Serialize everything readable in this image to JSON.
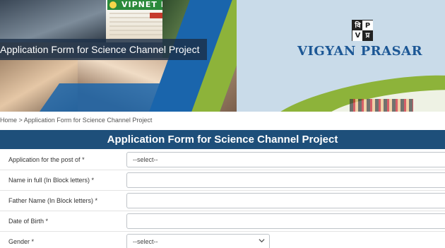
{
  "banner": {
    "title": "Application Form for Science Channel Project",
    "news_head": "VIPNET NEWS",
    "logo_glyphs": [
      "वि",
      "P",
      "V",
      "प्र"
    ],
    "brand_name": "VIGYAN PRASAR"
  },
  "breadcrumb": {
    "home": "Home",
    "separator": " > ",
    "current": "Application Form for Science Channel Project"
  },
  "form": {
    "heading": "Application Form for Science Channel Project",
    "fields": [
      {
        "label": "Application for the post of *",
        "type": "select",
        "value": "--select--"
      },
      {
        "label": "Name in full (In Block letters) *",
        "type": "text",
        "value": ""
      },
      {
        "label": "Father Name (In Block letters) *",
        "type": "text",
        "value": ""
      },
      {
        "label": "Date of Birth *",
        "type": "text",
        "value": ""
      },
      {
        "label": "Gender *",
        "type": "select",
        "value": "--select--"
      }
    ]
  },
  "colors": {
    "header_bg": "#1e4f7a",
    "brand": "#1c5795",
    "accent_green": "#8db33a",
    "accent_blue": "#1a65ac"
  },
  "icons": {
    "select_arrow": "chevron-down-icon"
  }
}
